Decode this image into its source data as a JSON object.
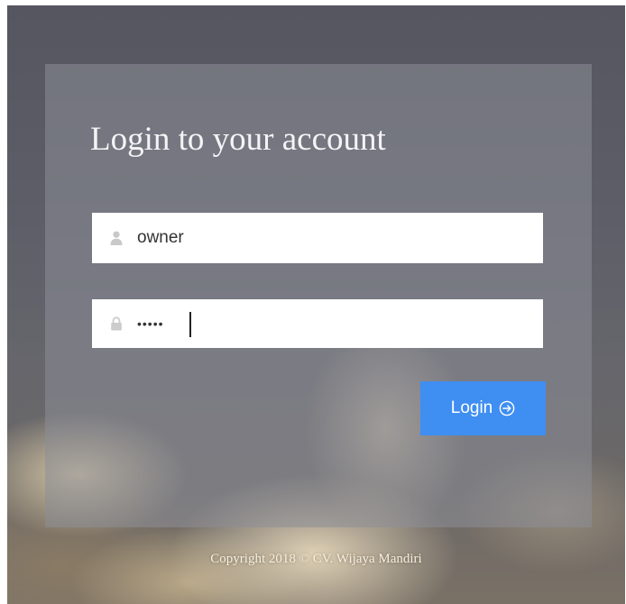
{
  "login": {
    "title": "Login to your account",
    "username": {
      "value": "owner",
      "icon": "user-icon"
    },
    "password": {
      "value": "•••••",
      "icon": "lock-icon"
    },
    "button_label": "Login",
    "button_icon": "arrow-circle-right-icon"
  },
  "footer": {
    "copyright": "Copyright 2018 © CV. Wijaya Mandiri"
  },
  "colors": {
    "accent": "#3f8ef2",
    "panel": "#8c8e98",
    "field_bg": "#ffffff"
  }
}
